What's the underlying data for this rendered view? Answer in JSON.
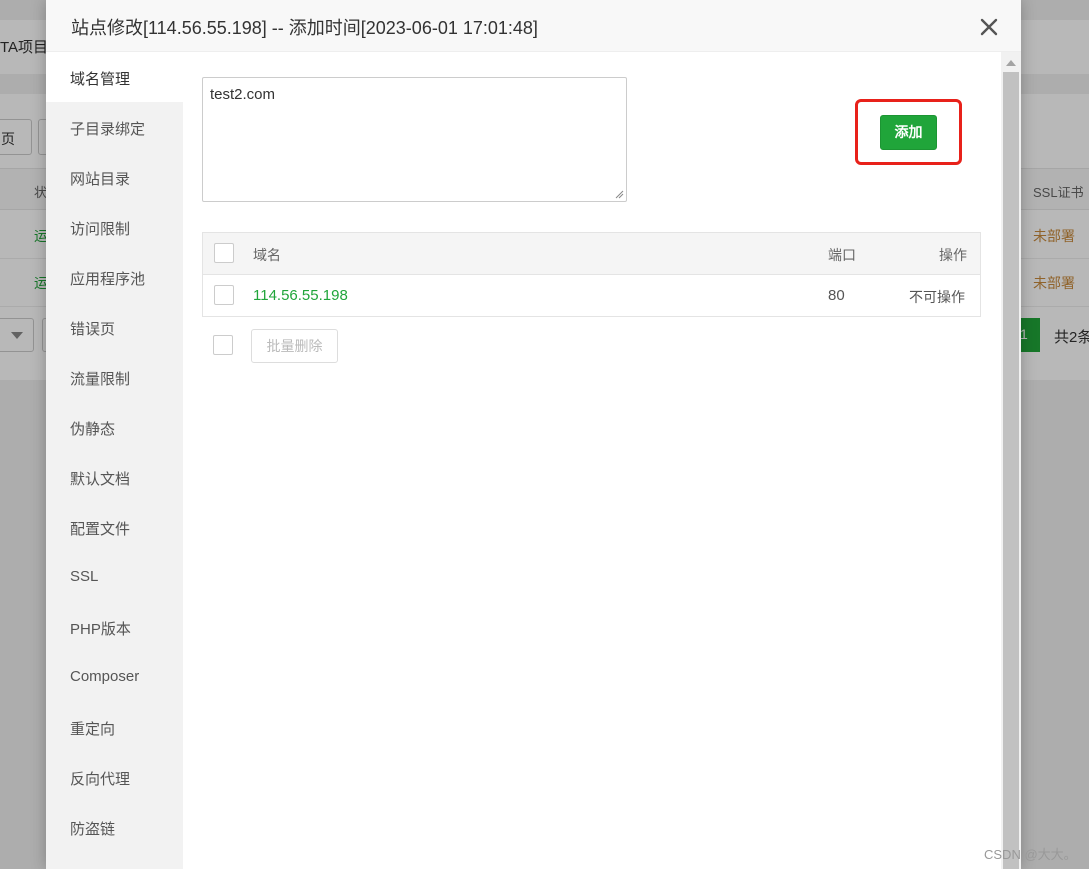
{
  "background": {
    "tab_fragment": "TA项目",
    "button_fragment": "页",
    "status_header_fragment": "状",
    "ssl_header_fragment": "SSL证书",
    "rows": [
      {
        "status_fragment": "运",
        "ssl": "未部署"
      },
      {
        "status_fragment": "运",
        "ssl": "未部署"
      }
    ],
    "current_page": "1",
    "total_fragment": "共2条"
  },
  "dialog": {
    "title": "站点修改[114.56.55.198] -- 添加时间[2023-06-01 17:01:48]",
    "close_icon": "close-x-icon"
  },
  "sidebar": {
    "items": [
      {
        "label": "域名管理",
        "active": true
      },
      {
        "label": "子目录绑定"
      },
      {
        "label": "网站目录"
      },
      {
        "label": "访问限制"
      },
      {
        "label": "应用程序池"
      },
      {
        "label": "错误页"
      },
      {
        "label": "流量限制"
      },
      {
        "label": "伪静态"
      },
      {
        "label": "默认文档"
      },
      {
        "label": "配置文件"
      },
      {
        "label": "SSL"
      },
      {
        "label": "PHP版本"
      },
      {
        "label": "Composer"
      },
      {
        "label": "重定向"
      },
      {
        "label": "反向代理"
      },
      {
        "label": "防盗链"
      }
    ]
  },
  "domain_form": {
    "textarea_value": "test2.com",
    "add_label": "添加"
  },
  "domain_table": {
    "headers": {
      "domain": "域名",
      "port": "端口",
      "action": "操作"
    },
    "rows": [
      {
        "domain": "114.56.55.198",
        "port": "80",
        "action": "不可操作"
      }
    ],
    "batch_delete_label": "批量删除"
  },
  "watermark": "CSDN @大大。",
  "colors": {
    "accent_green": "#20a53a",
    "highlight_red": "#e8211a",
    "warning_orange": "#c88a3c"
  }
}
